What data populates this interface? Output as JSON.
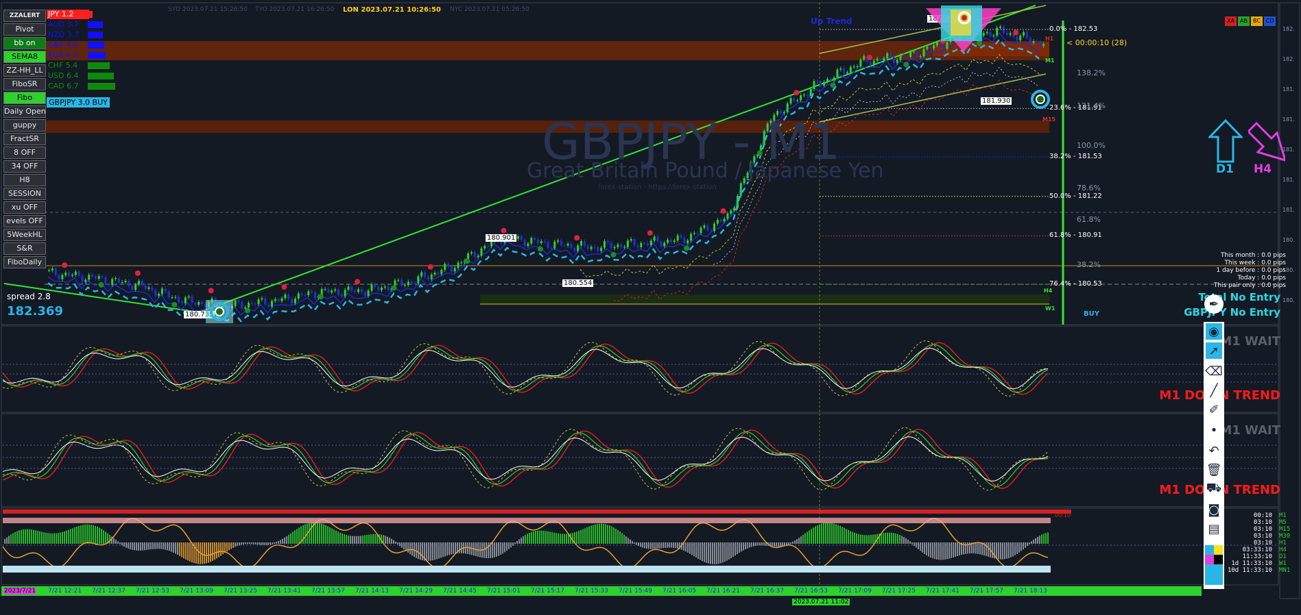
{
  "top_sessions": {
    "syd": "SYD 2023.07.21 15:26:50",
    "tyo": "TYO 2023.07.21 16:26:50",
    "lon": "LON 2023.07.21 10:26:50",
    "nyc": "NYC 2023.07.21 05:26:50"
  },
  "side_buttons": [
    "ZZALERT",
    "Pivot",
    "bb on",
    "SEMA8",
    "ZZ-HH_LL",
    "FiboSR",
    "Fibo",
    "Daily Open",
    "guppy",
    "FractSR",
    "8 OFF",
    "34 OFF",
    "H8",
    "SESSION",
    "xu OFF",
    "evels OFF",
    "5WeekHL",
    "S&R",
    "FiboDaily"
  ],
  "currency_strength": [
    {
      "label": "JPY",
      "value": "1.2",
      "color": "#ff2020"
    },
    {
      "label": "AUD",
      "value": "3.7",
      "color": "#1010ff"
    },
    {
      "label": "NZD",
      "value": "3.7",
      "color": "#1010ff"
    },
    {
      "label": "GBP",
      "value": "4.0",
      "color": "#1010ff"
    },
    {
      "label": "EUR",
      "value": "4.3",
      "color": "#1010ff"
    },
    {
      "label": "CHF",
      "value": "5.4",
      "color": "#0d8a0d"
    },
    {
      "label": "USD",
      "value": "6.4",
      "color": "#0d8a0d"
    },
    {
      "label": "CAD",
      "value": "6.7",
      "color": "#0d8a0d"
    }
  ],
  "signal_badge": "GBPJPY 3.0 BUY",
  "spread_label": "spread 2.8",
  "current_price": "182.369",
  "watermark": {
    "symbol": "GBPJPY - M1",
    "name": "Great Britain Pound / Japanese Yen",
    "site": "forex-station - https://forex-station"
  },
  "up_trend_label": "Up Trend",
  "countdown": "< 00:00:10 (28)",
  "fib_levels": [
    {
      "label": "0.0% - 182.53"
    },
    {
      "label": "23.6% - 181.91"
    },
    {
      "label": "38.2% - 181.53"
    },
    {
      "label": "50.0% - 181.22"
    },
    {
      "label": "61.8% - 180.91"
    },
    {
      "label": "76.4% - 180.53"
    }
  ],
  "ret_levels": [
    "138.2%",
    "121.4%",
    "100.0%",
    "78.6%",
    "61.8%",
    "38.2%"
  ],
  "price_tags": [
    "182.528",
    "181.930",
    "180.901",
    "180.554",
    "180.735"
  ],
  "tf_tags": {
    "h1": "H1",
    "m1": "M1",
    "m15": "M15",
    "h4": "H4",
    "w1": "W1"
  },
  "buy_label": "BUY",
  "arrows": {
    "d1": "D1",
    "h4": "H4"
  },
  "color_boxes": [
    {
      "label": "XA",
      "color": "#d42020"
    },
    {
      "label": "AB",
      "color": "#2aa12a"
    },
    {
      "label": "BC",
      "color": "#e8a600"
    },
    {
      "label": "CD",
      "color": "#2050d0"
    }
  ],
  "pips": [
    "This month : 0.0 pips",
    "This week : 0.0 pips",
    "1 day before : 0.0 pips",
    "Today : 0.0 pips",
    "This pair only : 0.0 pips"
  ],
  "entry": {
    "total": "Total No Entry",
    "pair": "GBPJPY No Entry"
  },
  "osc1": {
    "wait": "M1 WAIT",
    "trend": "M1 DOWN TREND"
  },
  "osc2": {
    "wait": "M1 WAIT",
    "trend": "M1 DOWN TREND"
  },
  "tf_timers": [
    {
      "time": "00:10",
      "tf": "M1"
    },
    {
      "time": "03:10",
      "tf": "M5"
    },
    {
      "time": "03:10",
      "tf": "M15"
    },
    {
      "time": "03:10",
      "tf": "M30"
    },
    {
      "time": "03:10",
      "tf": "H1"
    },
    {
      "time": "03:33:10",
      "tf": "H4"
    },
    {
      "time": "11:33:10",
      "tf": "D1"
    },
    {
      "time": "1d 11:33:10",
      "tf": "W1"
    },
    {
      "time": "10d 11:33:10",
      "tf": "MN1"
    }
  ],
  "osc3_label": "00:10",
  "session_labels": [
    "2023/7/21",
    "7/21 12:21",
    "7/21 12:37",
    "7/21 12:53",
    "7/21 13:09",
    "7/21 13:25",
    "7/21 13:41",
    "7/21 13:57",
    "7/21 14:13",
    "7/21 14:29",
    "7/21 14:45",
    "7/21 15:01",
    "7/21 15:17",
    "7/21 15:33",
    "7/21 15:49",
    "7/21 16:05",
    "7/21 16:21",
    "7/21 16:37",
    "7/21 16:53",
    "7/21 17:09",
    "7/21 17:25",
    "7/21 17:41",
    "7/21 17:57",
    "7/21 18:13"
  ],
  "cursor_time": "2023.07.21 11:02",
  "right_axis": [
    "182.",
    "182.",
    "181.",
    "181.",
    "181.",
    "181.",
    "181.",
    "180.",
    "180.",
    "180."
  ],
  "chart_data": {
    "type": "candlestick",
    "title": "GBPJPY - M1",
    "subtitle": "Great Britain Pound / Japanese Yen",
    "x": [
      "7/21 12:21",
      "7/21 12:37",
      "7/21 12:53",
      "7/21 13:09",
      "7/21 13:25",
      "7/21 13:41",
      "7/21 13:57",
      "7/21 14:13",
      "7/21 14:29",
      "7/21 14:45",
      "7/21 15:01",
      "7/21 15:17",
      "7/21 15:33",
      "7/21 15:49",
      "7/21 16:05",
      "7/21 16:21",
      "7/21 16:37",
      "7/21 16:53",
      "7/21 17:09",
      "7/21 17:25",
      "7/21 17:41",
      "7/21 17:57",
      "7/21 18:13"
    ],
    "close": [
      180.62,
      180.58,
      180.52,
      180.4,
      180.36,
      180.4,
      180.47,
      180.48,
      180.55,
      180.68,
      180.9,
      180.85,
      180.82,
      180.85,
      180.88,
      181.05,
      181.85,
      182.1,
      182.28,
      182.32,
      182.45,
      182.52,
      182.42
    ],
    "ylim": [
      180.3,
      182.6
    ],
    "fib_retracement": [
      {
        "level": "0.0%",
        "price": 182.53
      },
      {
        "level": "23.6%",
        "price": 181.91
      },
      {
        "level": "38.2%",
        "price": 181.53
      },
      {
        "level": "50.0%",
        "price": 181.22
      },
      {
        "level": "61.8%",
        "price": 180.91
      },
      {
        "level": "76.4%",
        "price": 180.53
      }
    ],
    "current_price": 182.369
  }
}
